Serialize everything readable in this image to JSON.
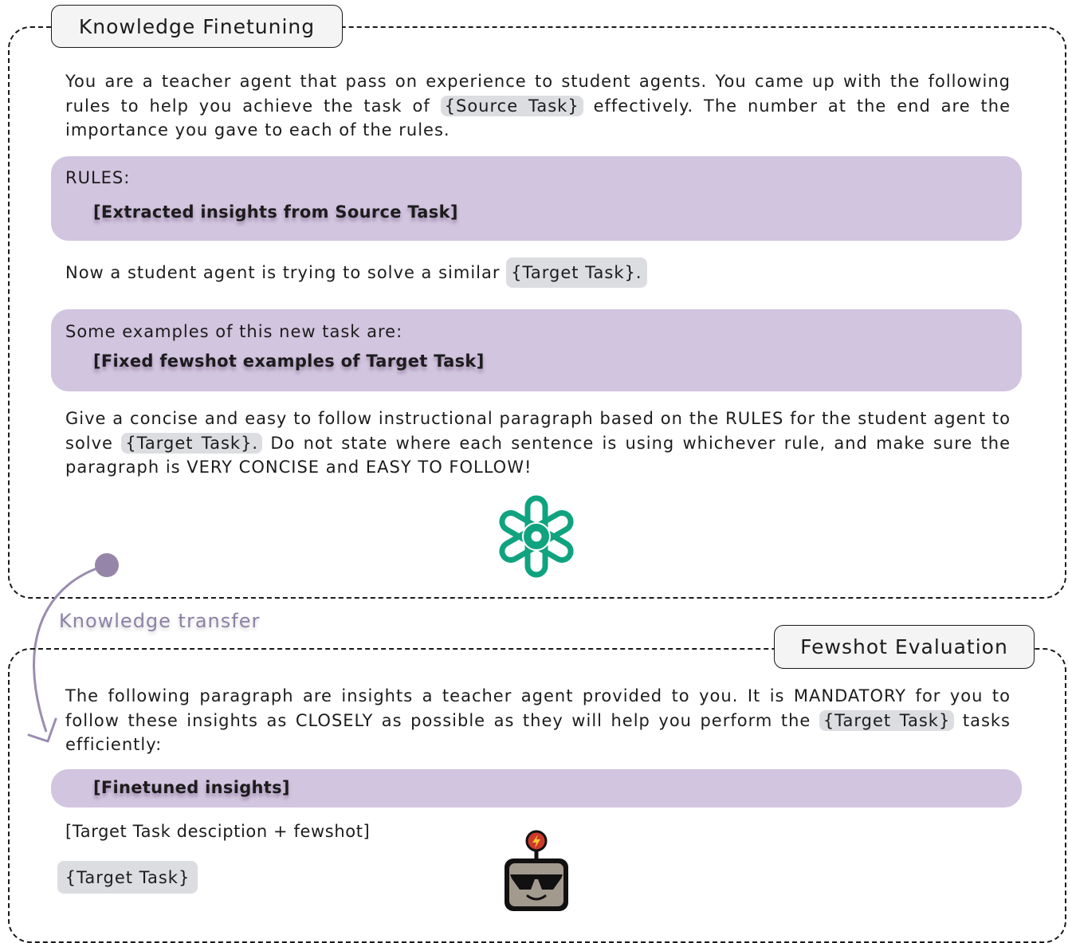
{
  "top_section": {
    "title": "Knowledge Finetuning",
    "intro": {
      "before": "You are a teacher agent that pass on experience to student agents. You came up with the following rules to help you achieve the task of ",
      "chip": "{Source Task}",
      "after": " effectively. The number at the end are the importance you gave to each of the rules."
    },
    "rules_box": {
      "label": "RULES:",
      "content": "[Extracted insights from Source Task]"
    },
    "student_line": {
      "before": "Now a student agent is trying to solve a similar ",
      "chip": "{Target Task}."
    },
    "examples_box": {
      "label": "Some examples of this new task are:",
      "content": "[Fixed fewshot examples of Target Task]"
    },
    "instruction": {
      "before": "Give a concise and easy to follow instructional paragraph based on the RULES for the student agent to solve ",
      "chip": "{Target Task}.",
      "after": " Do not state where each sentence is using whichever rule, and make sure the paragraph is VERY CONCISE and EASY TO FOLLOW!"
    },
    "logo_icon": "openai-logo-icon",
    "logo_color": "#10a37f"
  },
  "transfer": {
    "label": "Knowledge transfer",
    "arrow_color": "#9a8db0"
  },
  "bottom_section": {
    "title": "Fewshot Evaluation",
    "intro": {
      "before": "The following paragraph are insights a teacher agent provided to you. It is MANDATORY for you to follow these insights as CLOSELY as possible as they will help you perform the ",
      "chip": "{Target Task}",
      "after": " tasks efficiently:"
    },
    "finetuned_box": {
      "content": "[Finetuned insights]"
    },
    "task_description": "[Target Task desciption + fewshot]",
    "target_chip": "{Target Task}",
    "robot_icon": "robot-sunglasses-icon"
  },
  "colors": {
    "box_fill": "#d2c5df",
    "chip_fill": "#dcdde1",
    "border": "#1a1a1a"
  }
}
